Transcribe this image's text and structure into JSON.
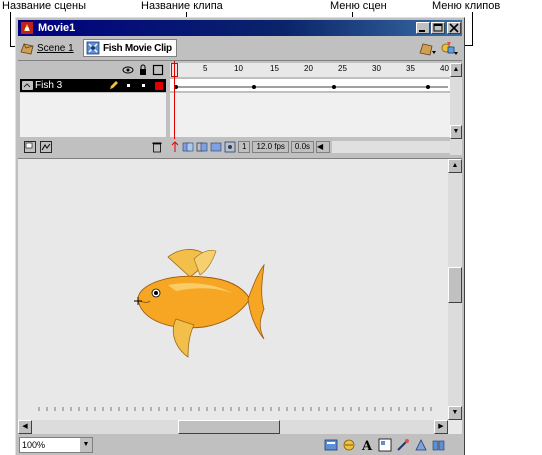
{
  "callouts": {
    "scene_name": "Название сцены",
    "clip_name": "Название клипа",
    "scene_menu": "Меню сцен",
    "clip_menu": "Меню клипов"
  },
  "window": {
    "title": "Movie1"
  },
  "editbar": {
    "scene_label": "Scene 1",
    "clip_label": "Fish Movie Clip"
  },
  "timeline": {
    "layer_name": "Fish 3",
    "ruler_ticks": [
      "5",
      "10",
      "15",
      "20",
      "25",
      "30",
      "35",
      "40"
    ],
    "current_frame": "1",
    "frame_rate": "12.0 fps",
    "elapsed": "0.0s"
  },
  "bottom": {
    "zoom": "100%"
  },
  "colors": {
    "fish_body": "#f6a623",
    "fish_fin": "#f2c04a",
    "title_bar": "#000080",
    "playhead": "#e00000"
  }
}
